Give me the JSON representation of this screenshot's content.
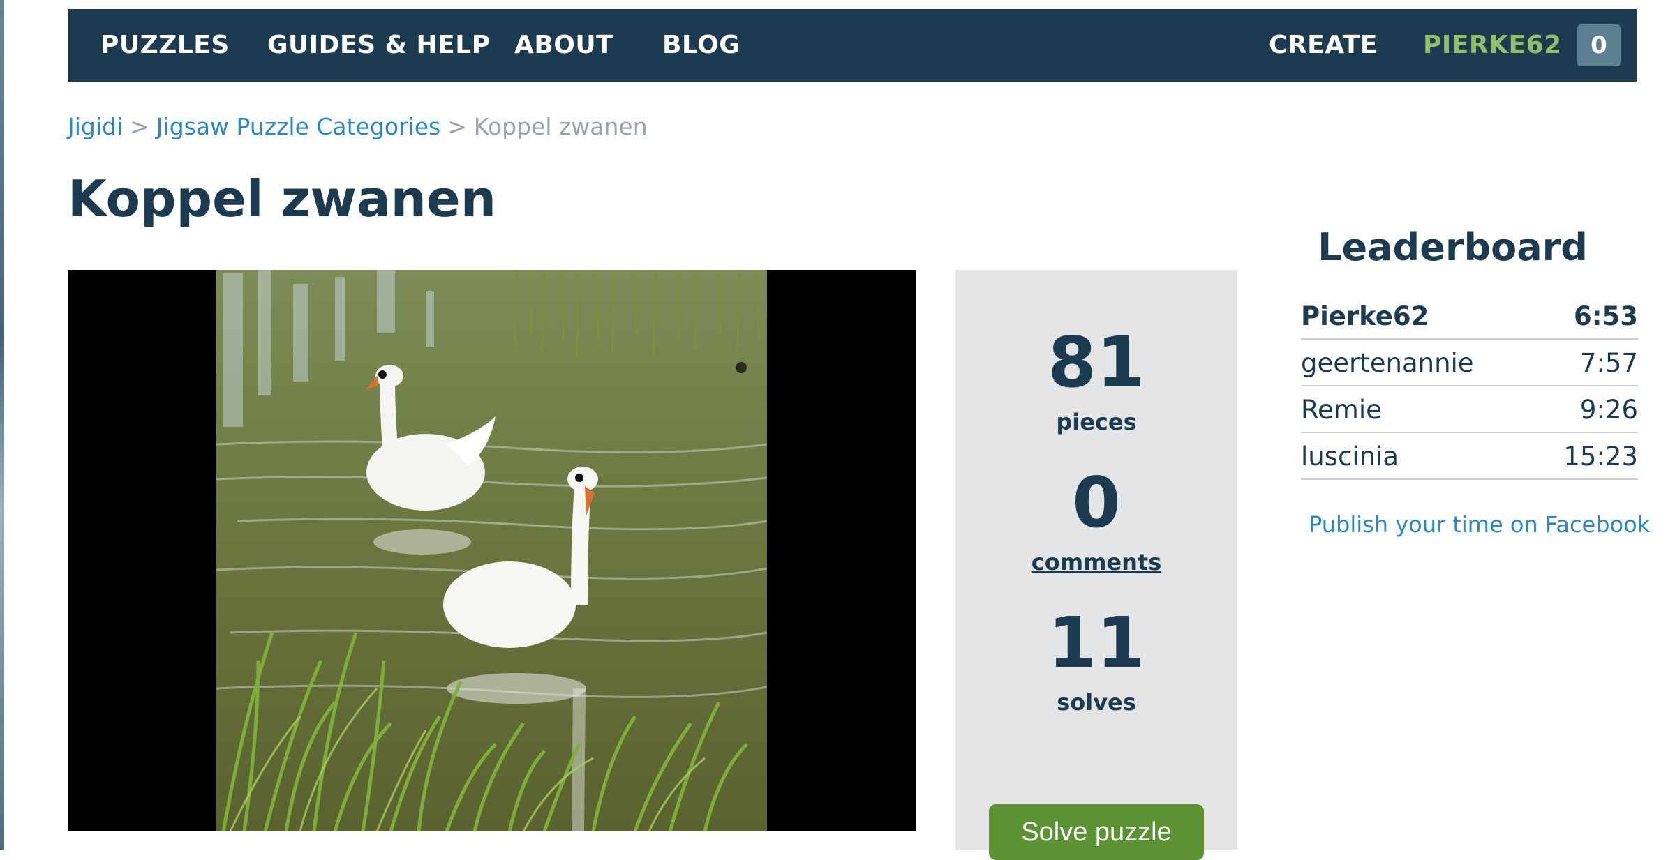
{
  "nav": {
    "items": [
      "PUZZLES",
      "GUIDES & HELP",
      "ABOUT",
      "BLOG"
    ],
    "create": "CREATE",
    "user": "PIERKE62",
    "badge_count": "0"
  },
  "breadcrumb": {
    "root": "Jigidi",
    "sep1": ">",
    "category": "Jigsaw Puzzle Categories",
    "sep2": ">",
    "current": "Koppel zwanen"
  },
  "puzzle": {
    "title": "Koppel zwanen"
  },
  "stats": {
    "pieces_value": "81",
    "pieces_label": "pieces",
    "comments_value": "0",
    "comments_label": "comments",
    "solves_value": "11",
    "solves_label": "solves",
    "solve_button": "Solve puzzle"
  },
  "leaderboard": {
    "title": "Leaderboard",
    "rows": [
      {
        "name": "Pierke62",
        "time": "6:53"
      },
      {
        "name": "geertenannie",
        "time": "7:57"
      },
      {
        "name": "Remie",
        "time": "9:26"
      },
      {
        "name": "luscinia",
        "time": "15:23"
      }
    ],
    "facebook_link": "Publish your time on Facebook"
  },
  "colors": {
    "nav_bg": "#1d3b50",
    "user_accent": "#8ec06c",
    "link": "#2e87c0",
    "solve_button": "#5a9234",
    "stats_bg": "#e3e5e7"
  }
}
